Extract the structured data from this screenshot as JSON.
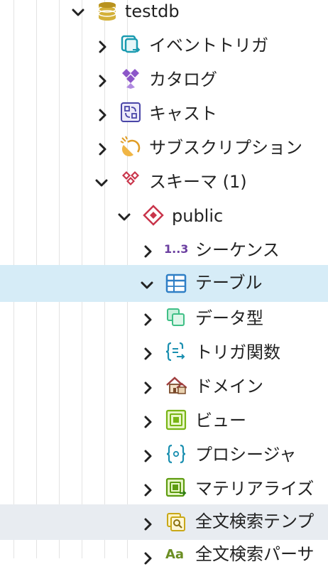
{
  "tree": {
    "database": {
      "label": "testdb"
    },
    "event_triggers": {
      "label": "イベントトリガ"
    },
    "catalogs": {
      "label": "カタログ"
    },
    "casts": {
      "label": "キャスト"
    },
    "subscriptions": {
      "label": "サブスクリプション"
    },
    "schemas": {
      "label": "スキーマ (1)"
    },
    "schema_public": {
      "label": "public"
    },
    "sequences": {
      "label": "シーケンス",
      "icon_text": "1..3"
    },
    "tables": {
      "label": "テーブル"
    },
    "types": {
      "label": "データ型"
    },
    "trigger_functions": {
      "label": "トリガ関数"
    },
    "domains": {
      "label": "ドメイン"
    },
    "views": {
      "label": "ビュー"
    },
    "procedures": {
      "label": "プロシージャ"
    },
    "materialized_views": {
      "label": "マテリアライズ"
    },
    "fts_templates": {
      "label": "全文検索テンプ"
    },
    "fts_parsers": {
      "label": "全文検索パーサ",
      "icon_text": "Aa"
    }
  },
  "colors": {
    "selected_row": "#d6ecf7",
    "hover_row": "#e8ecf1",
    "guide_line": "#e3e3e3"
  }
}
